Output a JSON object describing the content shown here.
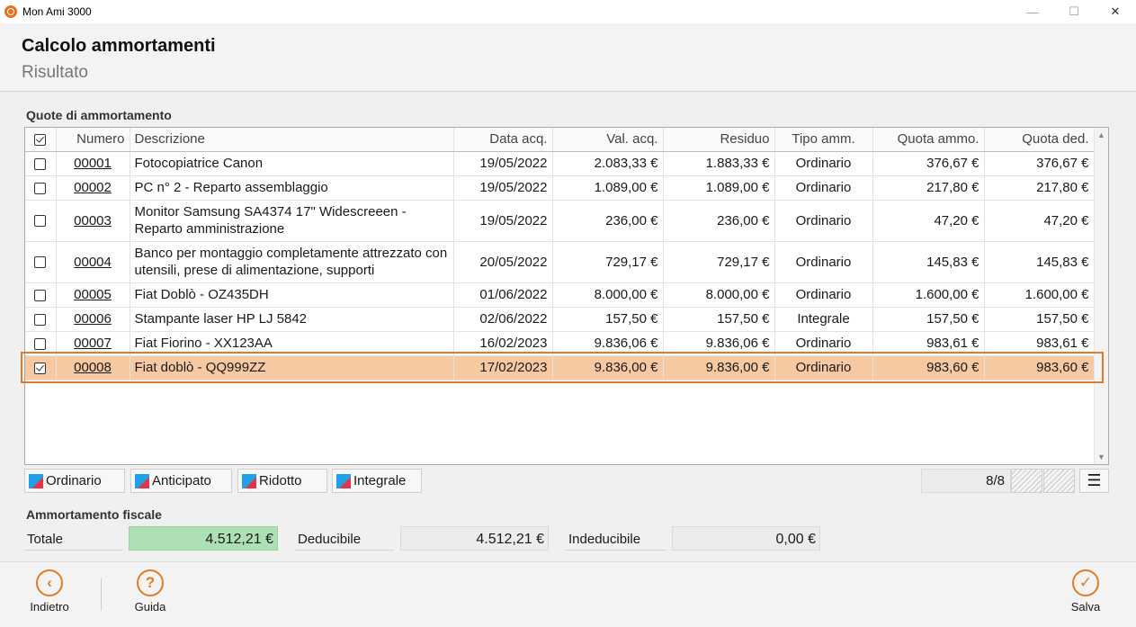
{
  "window": {
    "title": "Mon Ami 3000",
    "minimize": "—",
    "maximize": "☐",
    "close": "✕"
  },
  "header": {
    "title": "Calcolo ammortamenti",
    "subtitle": "Risultato"
  },
  "section_quote": "Quote di ammortamento",
  "table": {
    "columns": [
      "Numero",
      "Descrizione",
      "Data acq.",
      "Val. acq.",
      "Residuo",
      "Tipo amm.",
      "Quota ammo.",
      "Quota ded."
    ],
    "rows": [
      {
        "checked": false,
        "numero": "00001",
        "descrizione": "Fotocopiatrice Canon",
        "data": "19/05/2022",
        "val": "2.083,33 €",
        "residuo": "1.883,33 €",
        "tipo": "Ordinario",
        "quota_ammo": "376,67 €",
        "quota_ded": "376,67 €"
      },
      {
        "checked": false,
        "numero": "00002",
        "descrizione": "PC n° 2 - Reparto assemblaggio",
        "data": "19/05/2022",
        "val": "1.089,00 €",
        "residuo": "1.089,00 €",
        "tipo": "Ordinario",
        "quota_ammo": "217,80 €",
        "quota_ded": "217,80 €"
      },
      {
        "checked": false,
        "numero": "00003",
        "descrizione": "Monitor Samsung SA4374 17\" Widescreeen - Reparto amministrazione",
        "data": "19/05/2022",
        "val": "236,00 €",
        "residuo": "236,00 €",
        "tipo": "Ordinario",
        "quota_ammo": "47,20 €",
        "quota_ded": "47,20 €"
      },
      {
        "checked": false,
        "numero": "00004",
        "descrizione": "Banco per montaggio completamente attrezzato con utensili, prese di alimentazione, supporti",
        "data": "20/05/2022",
        "val": "729,17 €",
        "residuo": "729,17 €",
        "tipo": "Ordinario",
        "quota_ammo": "145,83 €",
        "quota_ded": "145,83 €"
      },
      {
        "checked": false,
        "numero": "00005",
        "descrizione": "Fiat Doblò - OZ435DH",
        "data": "01/06/2022",
        "val": "8.000,00 €",
        "residuo": "8.000,00 €",
        "tipo": "Ordinario",
        "quota_ammo": "1.600,00 €",
        "quota_ded": "1.600,00 €"
      },
      {
        "checked": false,
        "numero": "00006",
        "descrizione": "Stampante laser HP LJ 5842",
        "data": "02/06/2022",
        "val": "157,50 €",
        "residuo": "157,50 €",
        "tipo": "Integrale",
        "quota_ammo": "157,50 €",
        "quota_ded": "157,50 €"
      },
      {
        "checked": false,
        "numero": "00007",
        "descrizione": "Fiat Fiorino - XX123AA",
        "data": "16/02/2023",
        "val": "9.836,06 €",
        "residuo": "9.836,06 €",
        "tipo": "Ordinario",
        "quota_ammo": "983,61 €",
        "quota_ded": "983,61 €"
      },
      {
        "checked": true,
        "numero": "00008",
        "descrizione": "Fiat doblò - QQ999ZZ",
        "data": "17/02/2023",
        "val": "9.836,00 €",
        "residuo": "9.836,00 €",
        "tipo": "Ordinario",
        "quota_ammo": "983,60 €",
        "quota_ded": "983,60 €"
      }
    ]
  },
  "filters": {
    "ordinario": "Ordinario",
    "anticipato": "Anticipato",
    "ridotto": "Ridotto",
    "integrale": "Integrale"
  },
  "counter": "8/8",
  "menu_glyph": "☰",
  "section_fiscale": "Ammortamento fiscale",
  "totals": {
    "totale_label": "Totale",
    "totale_value": "4.512,21 €",
    "deducibile_label": "Deducibile",
    "deducibile_value": "4.512,21 €",
    "indeducibile_label": "Indeducibile",
    "indeducibile_value": "0,00 €"
  },
  "footer": {
    "back_label": "Indietro",
    "back_glyph": "‹",
    "help_label": "Guida",
    "help_glyph": "?",
    "save_label": "Salva",
    "save_glyph": "✓"
  },
  "colors": {
    "accent": "#e07b2a",
    "selected_row": "#f6c9a2",
    "total_green": "#aee0b5"
  }
}
